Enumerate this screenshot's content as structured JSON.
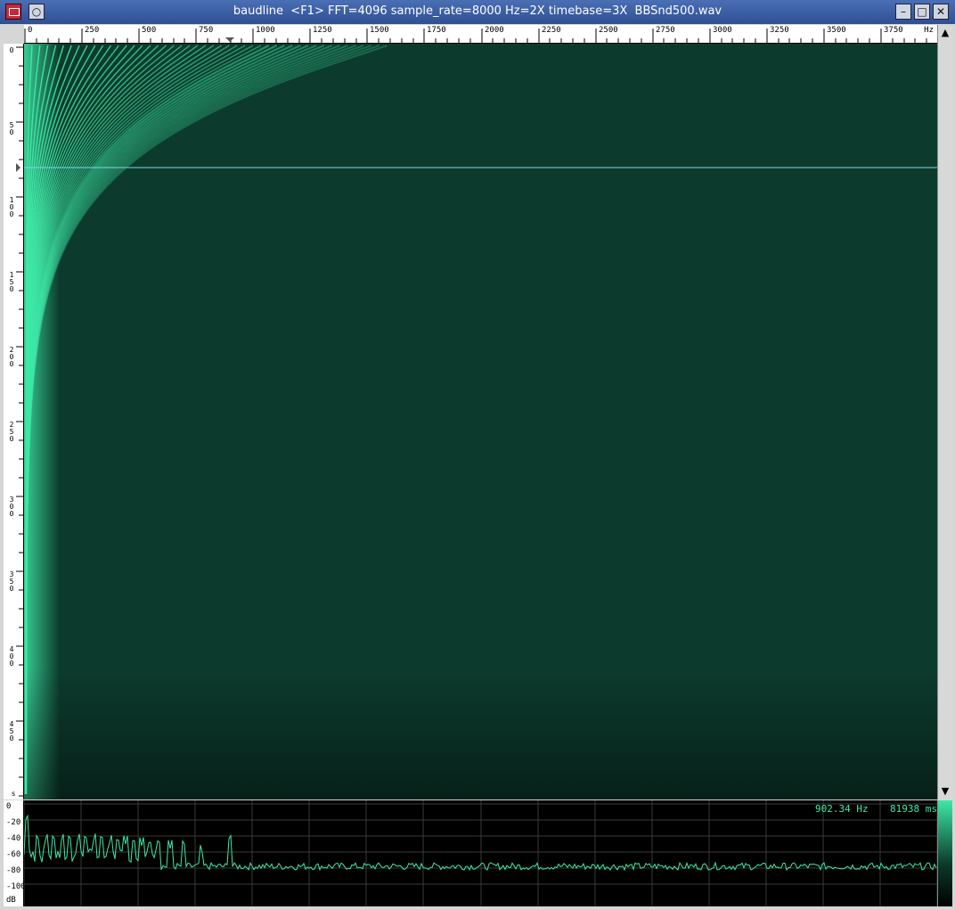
{
  "window": {
    "title": "baudline  <F1> FFT=4096 sample_rate=8000 Hz=2X timebase=3X  BBSnd500.wav",
    "buttons": {
      "minimize": "–",
      "maximize": "□",
      "close": "✕",
      "menu": "○"
    }
  },
  "freq_ruler": {
    "labels": [
      "0",
      "250",
      "500",
      "750",
      "1000",
      "1250",
      "1500",
      "1750",
      "2000",
      "2250",
      "2500",
      "2750",
      "3000",
      "3250",
      "3500",
      "3750"
    ],
    "unit": "Hz"
  },
  "time_ruler": {
    "labels": [
      "0",
      "5\n0",
      "1\n0\n0",
      "1\n5\n0",
      "2\n0\n0",
      "2\n5\n0",
      "3\n0\n0",
      "3\n5\n0",
      "4\n0\n0",
      "4\n5\n0"
    ],
    "unit": "s"
  },
  "db_scale": {
    "labels": [
      "0",
      "-20",
      "-40",
      "-60",
      "-80",
      "-100"
    ],
    "unit": "dB"
  },
  "readout": {
    "frequency": "902.34 Hz",
    "time": "81938 ms"
  },
  "colors": {
    "trace": "#3fe8a6",
    "background": "#0b3a2c",
    "cursor_line": "#7fd7e0"
  },
  "chart_data": {
    "type": "heatmap",
    "x_label": "Hz",
    "xlim": [
      0,
      4000
    ],
    "harmonic_spacing_hz": 35,
    "spectrum": {
      "ylabel": "dB",
      "ylim": [
        -100,
        0
      ],
      "peaks": [
        {
          "hz": 10,
          "db": -20
        },
        {
          "hz": 60,
          "db": -42
        },
        {
          "hz": 95,
          "db": -42
        },
        {
          "hz": 130,
          "db": -42
        },
        {
          "hz": 165,
          "db": -42
        },
        {
          "hz": 200,
          "db": -42
        },
        {
          "hz": 235,
          "db": -42
        },
        {
          "hz": 270,
          "db": -42
        },
        {
          "hz": 305,
          "db": -42
        },
        {
          "hz": 340,
          "db": -42
        },
        {
          "hz": 375,
          "db": -44
        },
        {
          "hz": 410,
          "db": -45
        },
        {
          "hz": 445,
          "db": -45
        },
        {
          "hz": 480,
          "db": -46
        },
        {
          "hz": 515,
          "db": -47
        },
        {
          "hz": 550,
          "db": -48
        },
        {
          "hz": 590,
          "db": -47
        },
        {
          "hz": 640,
          "db": -50
        },
        {
          "hz": 700,
          "db": -48
        },
        {
          "hz": 780,
          "db": -55
        },
        {
          "hz": 900,
          "db": -42
        }
      ],
      "noise_floor_db": -70
    }
  }
}
